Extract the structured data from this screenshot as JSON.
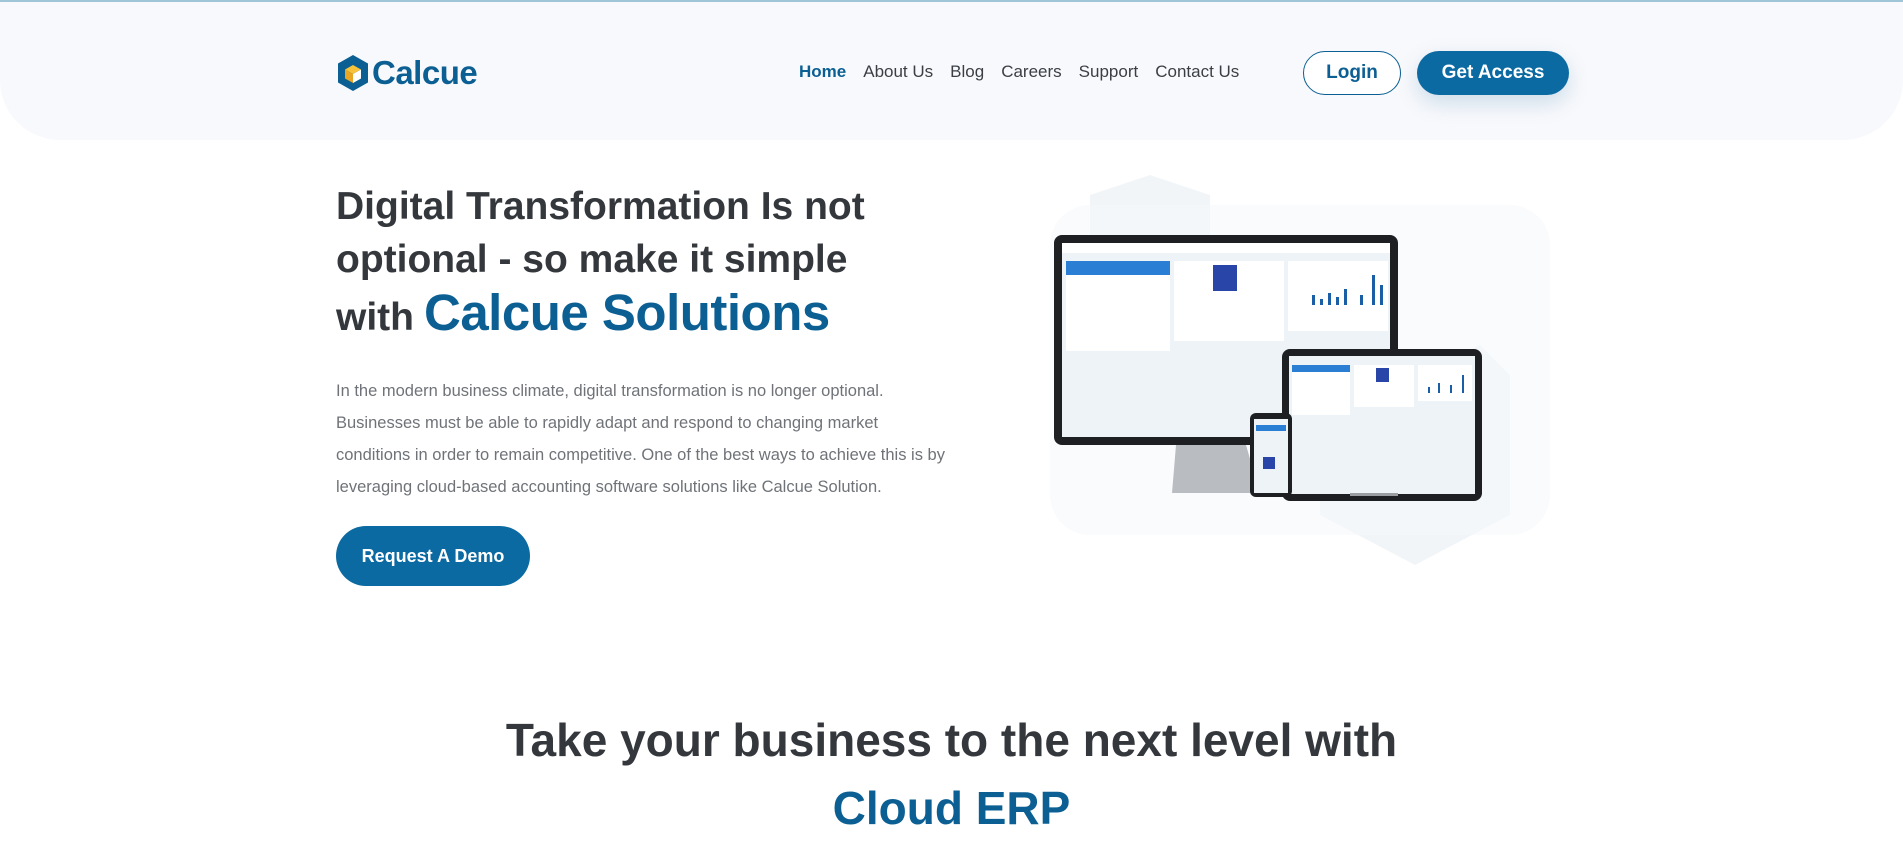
{
  "header": {
    "logo_text": "Calcue",
    "nav": [
      {
        "label": "Home",
        "active": true
      },
      {
        "label": "About Us",
        "active": false
      },
      {
        "label": "Blog",
        "active": false
      },
      {
        "label": "Careers",
        "active": false
      },
      {
        "label": "Support",
        "active": false
      },
      {
        "label": "Contact Us",
        "active": false
      }
    ],
    "login_label": "Login",
    "access_label": "Get Access"
  },
  "hero": {
    "title_line1": "Digital Transformation Is not",
    "title_line2": "optional - so make it simple",
    "title_with": "with",
    "title_brand": "Calcue Solutions",
    "description": "In the modern business climate, digital transformation is no longer optional. Businesses must be able to rapidly adapt and respond to changing market conditions in order to remain competitive. One of the best ways to achieve this is by leveraging cloud-based accounting software solutions like Calcue Solution.",
    "cta_label": "Request A Demo"
  },
  "section": {
    "title_line1": "Take your business to the next level with",
    "title_line2": "Cloud ERP"
  },
  "colors": {
    "brand": "#0b5f93",
    "button": "#0b6aa1",
    "heading": "#34383d",
    "body_text": "#6f7378",
    "header_bg": "#f8f9fc"
  },
  "icons": {
    "logo": "hexagon-cube-icon"
  }
}
